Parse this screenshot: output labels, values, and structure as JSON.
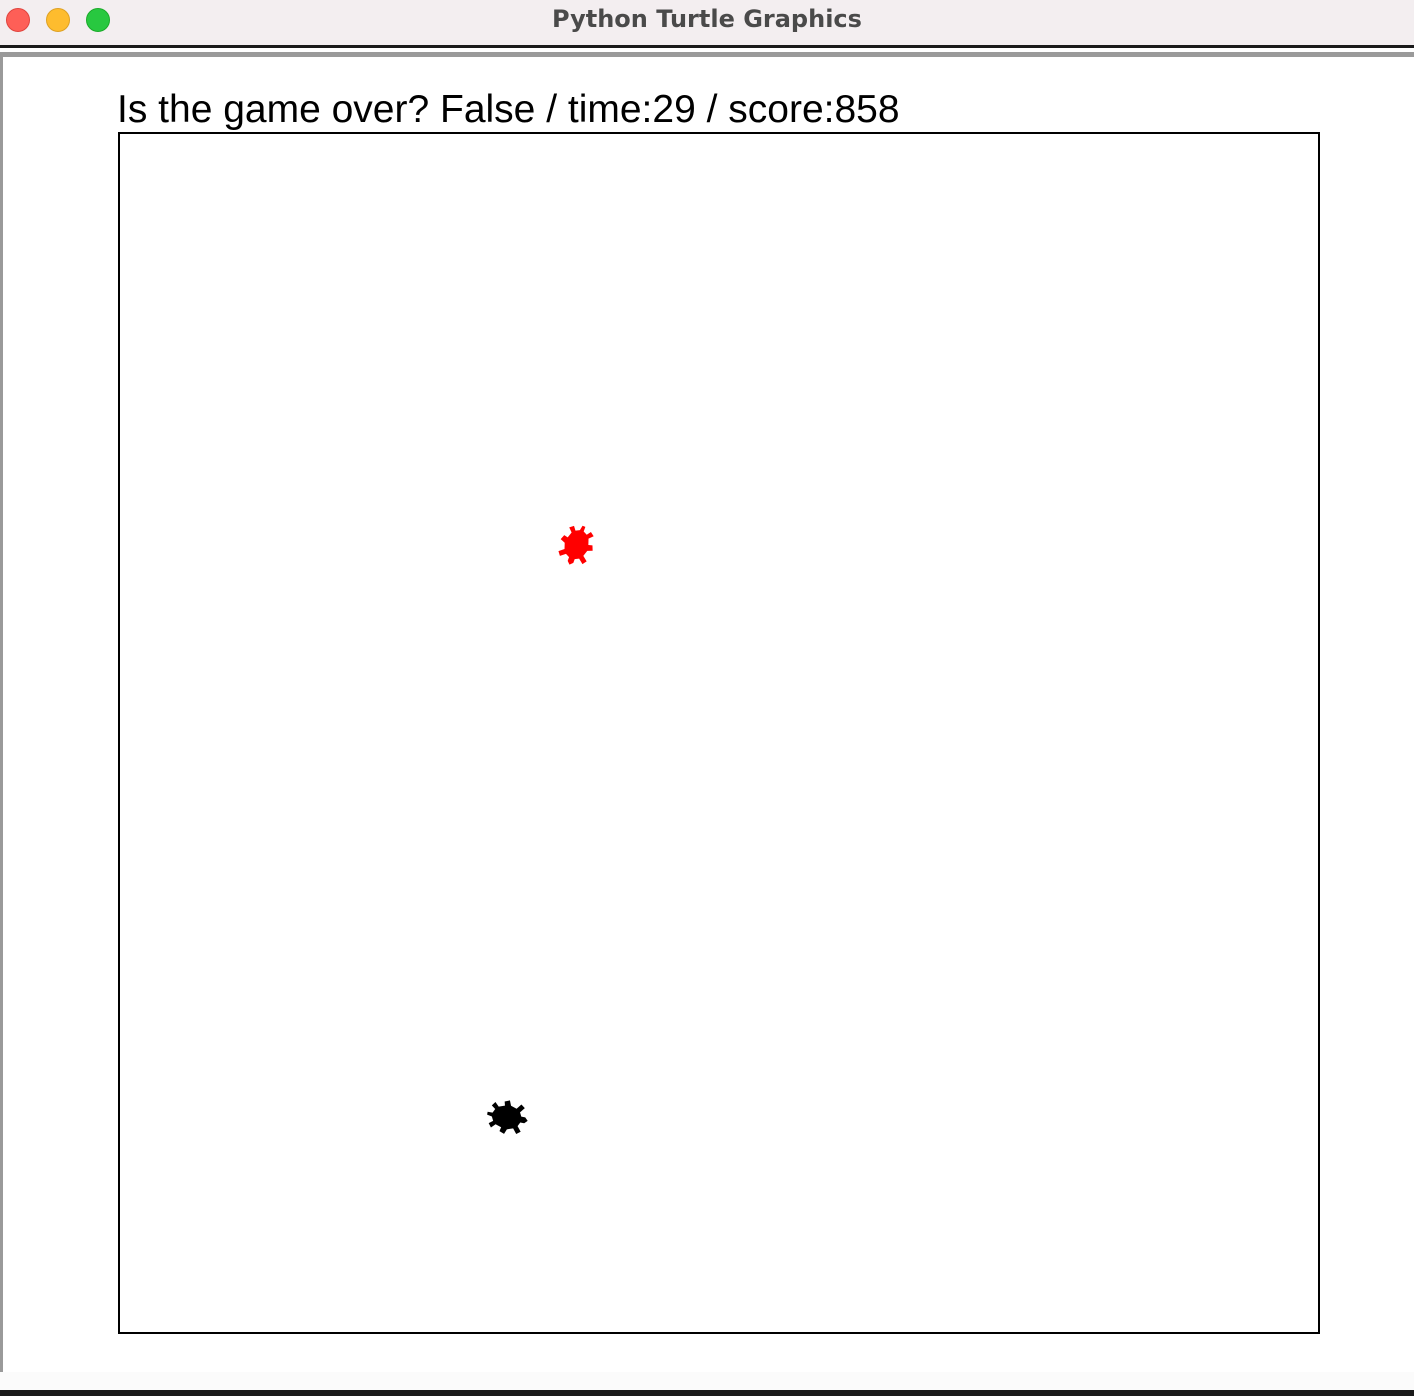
{
  "window": {
    "title": "Python Turtle Graphics"
  },
  "status": {
    "text": "Is the game over? False / time:29 / score:858",
    "game_over": false,
    "time": 29,
    "score": 858
  },
  "sprites": {
    "target_turtle": {
      "icon": "turtle-icon",
      "color": "#ff0000"
    },
    "player_turtle": {
      "icon": "turtle-icon",
      "color": "#000000"
    }
  }
}
